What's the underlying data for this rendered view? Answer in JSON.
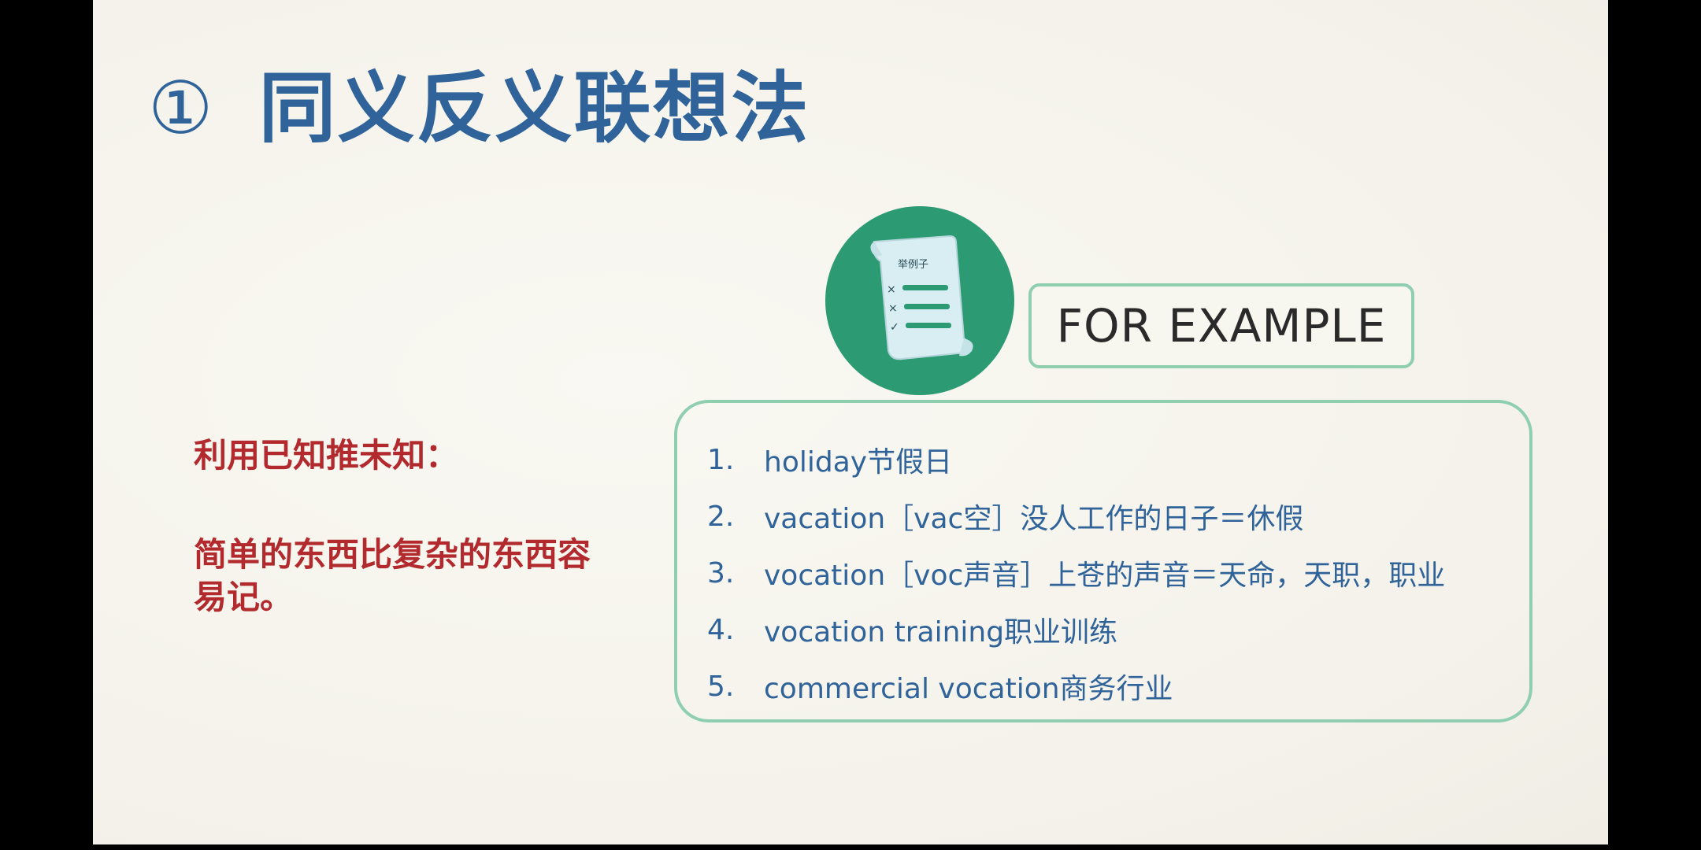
{
  "slide": {
    "title_number": "①",
    "title": "同义反义联想法"
  },
  "left_note": {
    "heading": "利用已知推未知：",
    "body": "简单的东西比复杂的东西容易记。"
  },
  "icon": {
    "name": "checklist-scroll-icon",
    "label": "举例子",
    "circle_color": "#2c9a73"
  },
  "for_example_label": "FOR EXAMPLE",
  "examples": [
    {
      "num": "1.",
      "text": "holiday节假日"
    },
    {
      "num": "2.",
      "text": "vacation［vac空］没人工作的日子＝休假"
    },
    {
      "num": "3.",
      "text": "vocation［voc声音］上苍的声音＝天命，天职，职业"
    },
    {
      "num": "4.",
      "text": "vocation training职业训练"
    },
    {
      "num": "5.",
      "text": "commercial vocation商务行业"
    }
  ],
  "colors": {
    "title_blue": "#2f6399",
    "note_red": "#b22a2e",
    "accent_green": "#2c9a73",
    "border_green": "#8fcfb0",
    "slide_bg": "#f6f4ec"
  }
}
